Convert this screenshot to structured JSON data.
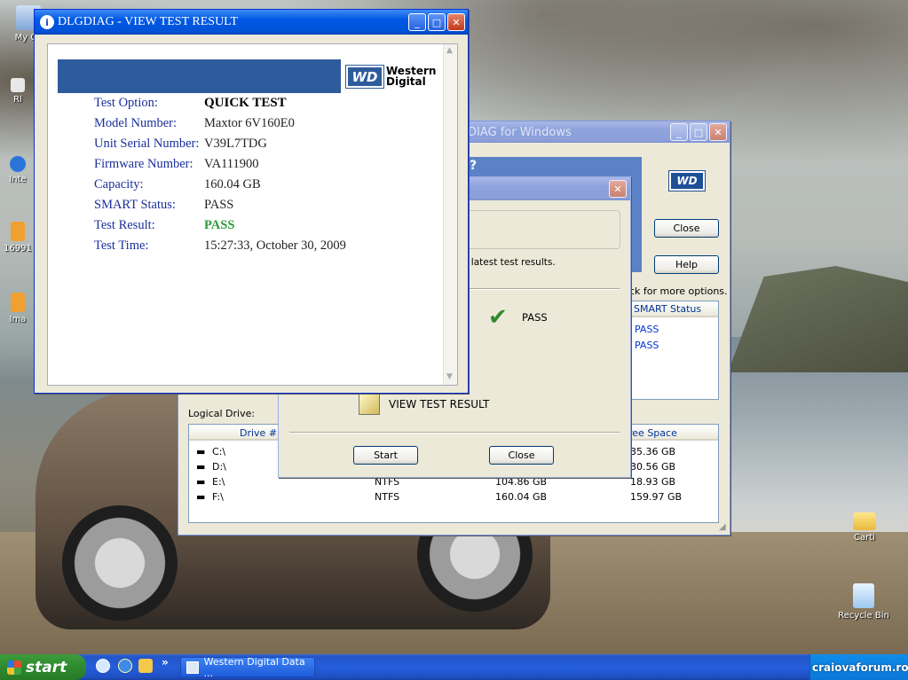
{
  "desktop": {
    "icons_left": [
      {
        "label": "My Co",
        "icon": "my-computer-icon"
      },
      {
        "label": "Rl",
        "icon": "shortcut-icon"
      },
      {
        "label": "Inte",
        "icon": "internet-explorer-icon"
      },
      {
        "label": "16991",
        "icon": "jpg-file-icon"
      },
      {
        "label": "Ima",
        "icon": "jpg-file-icon"
      }
    ],
    "icons_right": [
      {
        "label": "Carti",
        "icon": "folder-icon"
      },
      {
        "label": "Recycle Bin",
        "icon": "recycle-bin-icon"
      }
    ],
    "watermark": "craiovaforum.ro"
  },
  "main_window": {
    "title": "Western Digital Data LifeGuard Diagnostic for Windows",
    "title_visible": "DIAG for Windows",
    "prompt_fragment": "?",
    "close_label": "Close",
    "help_label": "Help",
    "options_hint": "ck for more options.",
    "smart_header": "SMART Status",
    "smart_values": [
      "PASS",
      "PASS"
    ],
    "logical_drive_label": "Logical Drive:",
    "logical_columns": [
      "Drive #",
      "",
      "",
      "ree Space"
    ],
    "logical_rows": [
      {
        "drive": "C:\\",
        "fs": "",
        "size": "",
        "free": "35.36 GB"
      },
      {
        "drive": "D:\\",
        "fs": "",
        "size": "",
        "free": "30.56 GB"
      },
      {
        "drive": "E:\\",
        "fs": "NTFS",
        "size": "104.86 GB",
        "free": "18.93 GB"
      },
      {
        "drive": "F:\\",
        "fs": "NTFS",
        "size": "160.04 GB",
        "free": "159.97 GB"
      }
    ]
  },
  "test_dialog": {
    "info_fragment": "e latest test results.",
    "result": "PASS",
    "view_result_label": "VIEW TEST RESULT",
    "start_label": "Start",
    "close_label": "Close"
  },
  "result_window": {
    "title": "DLGDIAG - VIEW TEST RESULT",
    "logo_line1": "Western",
    "logo_line2": "Digital",
    "logo_mark": "WD",
    "rows": [
      {
        "label": "Test Option:",
        "value": "QUICK TEST"
      },
      {
        "label": "Model Number:",
        "value": "Maxtor 6V160E0"
      },
      {
        "label": "Unit Serial Number:",
        "value": "V39L7TDG"
      },
      {
        "label": "Firmware Number:",
        "value": "VA111900"
      },
      {
        "label": "Capacity:",
        "value": "160.04 GB"
      },
      {
        "label": "SMART Status:",
        "value": "PASS"
      },
      {
        "label": "Test Result:",
        "value": "PASS"
      },
      {
        "label": "Test Time:",
        "value": "15:27:33, October 30, 2009"
      }
    ],
    "header_color": "#2e5b9c",
    "pass_color": "#2e9a3a"
  },
  "taskbar": {
    "start_label": "start",
    "task_label": "Western Digital Data ...",
    "overflow": "»"
  }
}
